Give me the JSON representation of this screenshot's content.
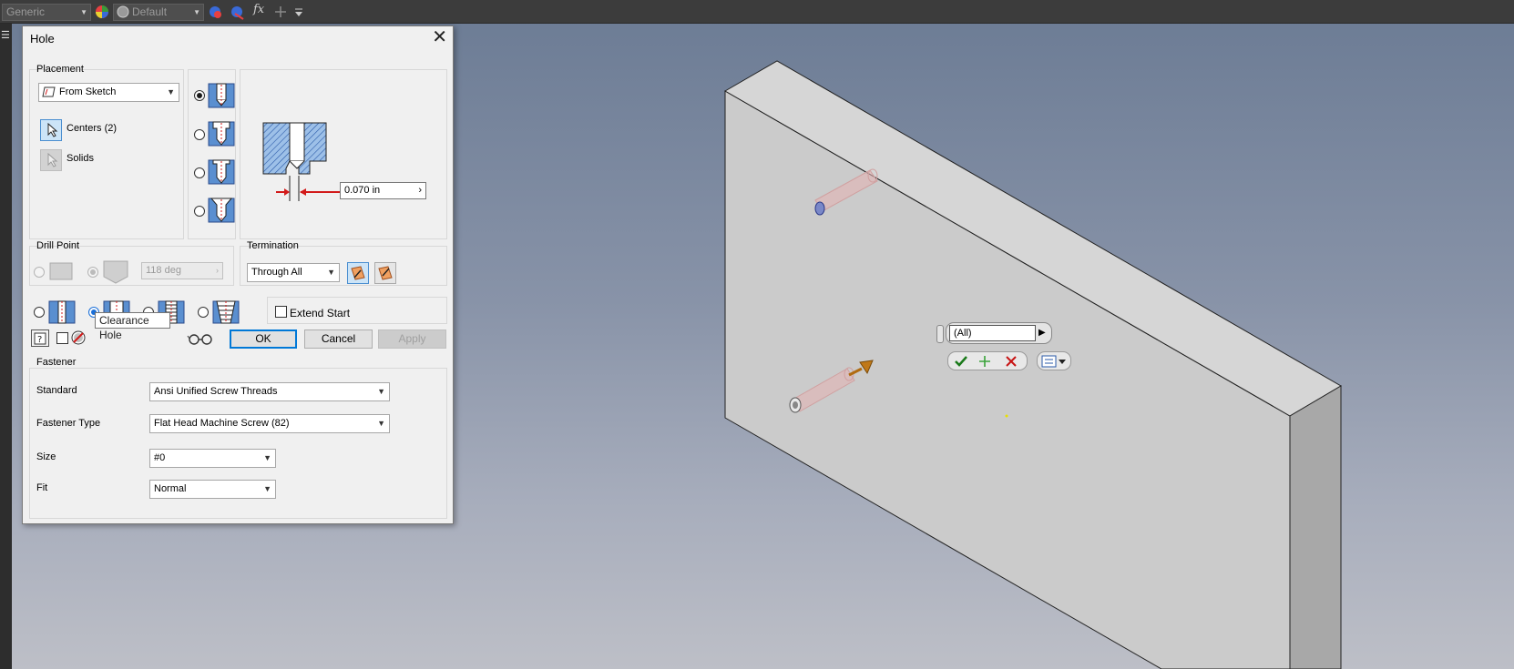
{
  "toolbar": {
    "material": "Generic",
    "appearance": "Default",
    "fx_label": "fx"
  },
  "dialog": {
    "title": "Hole",
    "placement": {
      "label": "Placement",
      "type": "From Sketch",
      "centers": "Centers (2)",
      "solids": "Solids"
    },
    "hole_type_selected_index": 0,
    "diameter_value": "0.070 in",
    "drill_point": {
      "label": "Drill Point",
      "angle": "118 deg"
    },
    "termination": {
      "label": "Termination",
      "value": "Through All"
    },
    "extend_start": "Extend Start",
    "tooltip": "Clearance Hole",
    "buttons": {
      "ok": "OK",
      "cancel": "Cancel",
      "apply": "Apply"
    },
    "fastener": {
      "label": "Fastener",
      "standard_label": "Standard",
      "standard_value": "Ansi Unified Screw Threads",
      "type_label": "Fastener Type",
      "type_value": "Flat Head Machine Screw (82)",
      "size_label": "Size",
      "size_value": "#0",
      "fit_label": "Fit",
      "fit_value": "Normal"
    }
  },
  "mini_toolbar": {
    "selector_value": "(All)"
  },
  "colors": {
    "accent_blue": "#0078d7",
    "hatch_blue": "#5a8fd0",
    "arrow_red": "#d21a1a",
    "part_face": "#cacaca",
    "part_side": "#a9a9a9"
  }
}
